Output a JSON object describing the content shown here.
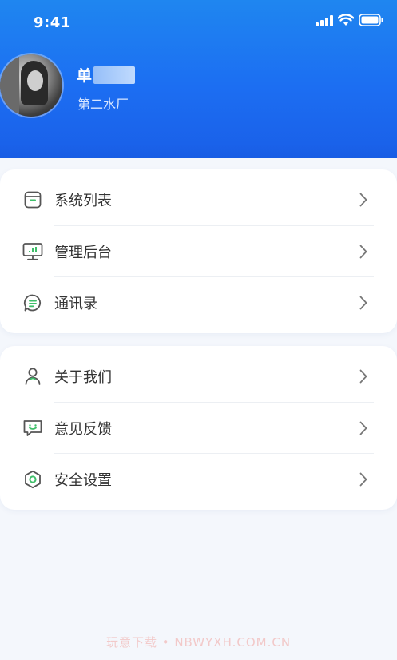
{
  "status_bar": {
    "time": "9:41"
  },
  "profile": {
    "name": "单",
    "organization": "第二水厂"
  },
  "menu_group_1": [
    {
      "label": "系统列表",
      "icon": "box-icon"
    },
    {
      "label": "管理后台",
      "icon": "monitor-chart-icon"
    },
    {
      "label": "通讯录",
      "icon": "chat-bubble-icon"
    }
  ],
  "menu_group_2": [
    {
      "label": "关于我们",
      "icon": "person-icon"
    },
    {
      "label": "意见反馈",
      "icon": "feedback-icon"
    },
    {
      "label": "安全设置",
      "icon": "hexagon-shield-icon"
    }
  ],
  "colors": {
    "header": "#1c6ef2",
    "icon_accent": "#3fbf6a",
    "icon_gray": "#5a5a5a"
  },
  "watermark": "玩意下载 • NBWYXH.COM.CN"
}
